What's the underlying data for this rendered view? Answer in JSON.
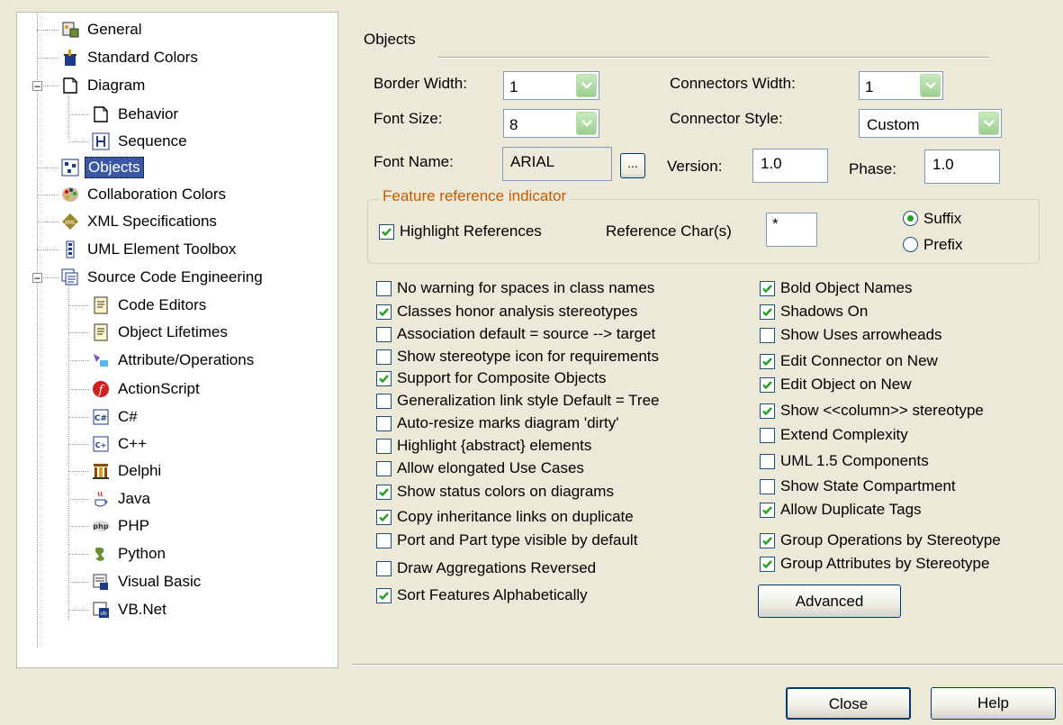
{
  "tree": {
    "items": [
      {
        "label": "General",
        "icon": "general-icon"
      },
      {
        "label": "Standard Colors",
        "icon": "paint-icon"
      },
      {
        "label": "Diagram",
        "icon": "page-icon"
      },
      {
        "label": "Behavior",
        "icon": "page-icon"
      },
      {
        "label": "Sequence",
        "icon": "sequence-icon"
      },
      {
        "label": "Objects",
        "icon": "objects-icon",
        "selected": true
      },
      {
        "label": "Collaboration Colors",
        "icon": "palette-icon"
      },
      {
        "label": "XML Specifications",
        "icon": "xml-icon"
      },
      {
        "label": "UML Element Toolbox",
        "icon": "toolbox-icon"
      },
      {
        "label": "Source Code Engineering",
        "icon": "source-code-icon"
      },
      {
        "label": "Code Editors",
        "icon": "code-doc-icon"
      },
      {
        "label": "Object Lifetimes",
        "icon": "code-doc-icon"
      },
      {
        "label": "Attribute/Operations",
        "icon": "attribute-icon"
      },
      {
        "label": "ActionScript",
        "icon": "actionscript-icon"
      },
      {
        "label": "C#",
        "icon": "csharp-icon"
      },
      {
        "label": "C++",
        "icon": "cpp-icon"
      },
      {
        "label": "Delphi",
        "icon": "delphi-icon"
      },
      {
        "label": "Java",
        "icon": "java-icon"
      },
      {
        "label": "PHP",
        "icon": "php-icon"
      },
      {
        "label": "Python",
        "icon": "python-icon"
      },
      {
        "label": "Visual Basic",
        "icon": "vb-icon"
      },
      {
        "label": "VB.Net",
        "icon": "vbnet-icon"
      }
    ]
  },
  "objects": {
    "section_title": "Objects",
    "border_width_label": "Border Width:",
    "border_width_value": "1",
    "connectors_width_label": "Connectors Width:",
    "connectors_width_value": "1",
    "font_size_label": "Font Size:",
    "font_size_value": "8",
    "connector_style_label": "Connector Style:",
    "connector_style_value": "Custom",
    "font_name_label": "Font Name:",
    "font_name_value": "ARIAL",
    "browse_label": "...",
    "version_label": "Version:",
    "version_value": "1.0",
    "phase_label": "Phase:",
    "phase_value": "1.0"
  },
  "feature_ref": {
    "legend": "Feature reference indicator",
    "highlight_label": "Highlight References",
    "highlight_checked": true,
    "reference_chars_label": "Reference Char(s)",
    "reference_chars_value": "*",
    "suffix_label": "Suffix",
    "prefix_label": "Prefix",
    "selected": "Suffix"
  },
  "left_options": [
    {
      "label": "No warning for spaces in class names",
      "checked": false
    },
    {
      "label": "Classes honor analysis stereotypes",
      "checked": true
    },
    {
      "label": "Association default = source --> target",
      "checked": false
    },
    {
      "label": "Show stereotype icon for requirements",
      "checked": false
    },
    {
      "label": "Support for Composite Objects",
      "checked": true
    },
    {
      "label": "Generalization link style Default = Tree",
      "checked": false
    },
    {
      "label": "Auto-resize marks diagram 'dirty'",
      "checked": false
    },
    {
      "label": "Highlight {abstract} elements",
      "checked": false
    },
    {
      "label": "Allow elongated Use Cases",
      "checked": false
    },
    {
      "label": "Show status colors on diagrams",
      "checked": true
    },
    {
      "label": "Copy inheritance links on duplicate",
      "checked": true
    },
    {
      "label": "Port and Part type visible by default",
      "checked": false
    },
    {
      "label": "Draw Aggregations Reversed",
      "checked": false
    },
    {
      "label": "Sort Features Alphabetically",
      "checked": true
    }
  ],
  "right_options": [
    {
      "label": "Bold Object Names",
      "checked": true
    },
    {
      "label": "Shadows On",
      "checked": true
    },
    {
      "label": "Show Uses arrowheads",
      "checked": false
    },
    {
      "label": "Edit Connector on New",
      "checked": true
    },
    {
      "label": "Edit Object on New",
      "checked": true
    },
    {
      "label": "Show <<column>> stereotype",
      "checked": true
    },
    {
      "label": "Extend Complexity",
      "checked": false
    },
    {
      "label": "UML 1.5 Components",
      "checked": false
    },
    {
      "label": "Show State Compartment",
      "checked": false
    },
    {
      "label": "Allow Duplicate Tags",
      "checked": true
    },
    {
      "label": "Group Operations by Stereotype",
      "checked": true
    },
    {
      "label": "Group Attributes by Stereotype",
      "checked": true
    }
  ],
  "buttons": {
    "advanced": "Advanced",
    "close": "Close",
    "help": "Help"
  },
  "colors": {
    "dialog_bg": "#ECE9D8",
    "selection": "#3a57a6",
    "legend_text": "#c75a00",
    "check_mark": "#21a121"
  }
}
